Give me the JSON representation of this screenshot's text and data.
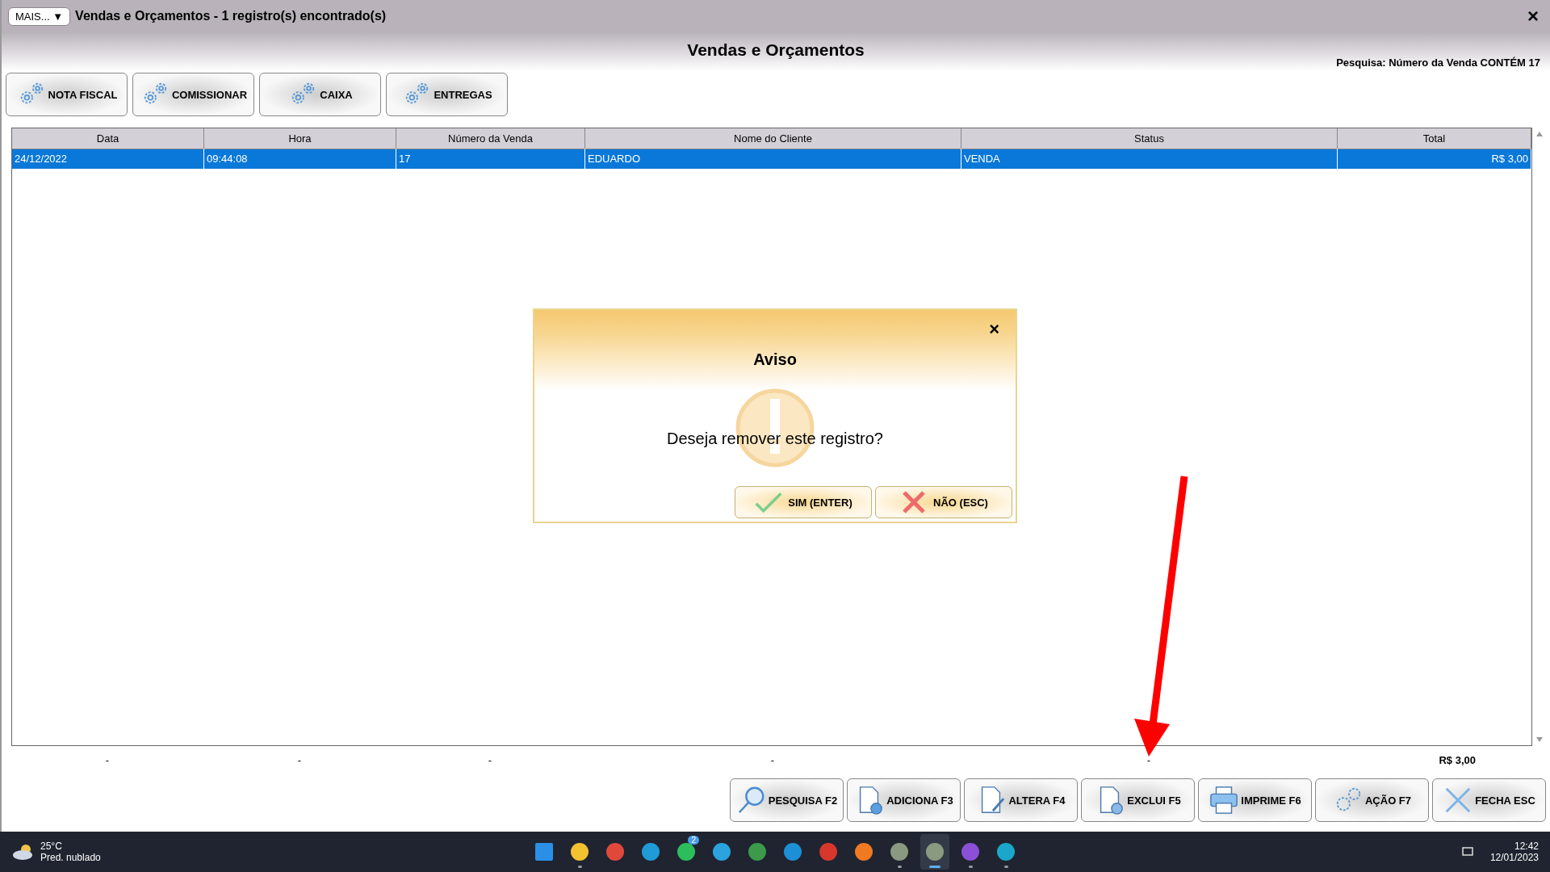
{
  "window": {
    "menu_button": "MAIS...",
    "menu_caret": "▼",
    "title": "Vendas e Orçamentos - 1 registro(s) encontrado(s)",
    "close": "×"
  },
  "heading": "Vendas e Orçamentos",
  "search_summary": "Pesquisa: Número da Venda CONTÉM 17",
  "toolbar": [
    "NOTA FISCAL",
    "COMISSIONAR",
    "CAIXA",
    "ENTREGAS"
  ],
  "table": {
    "columns": [
      "Data",
      "Hora",
      "Número da Venda",
      "Nome do Cliente",
      "Status",
      "Total"
    ],
    "rows": [
      {
        "selected": true,
        "cells": [
          "24/12/2022",
          "09:44:08",
          "17",
          "EDUARDO",
          "VENDA",
          "R$ 3,00"
        ]
      }
    ],
    "footer": [
      "-",
      "-",
      "-",
      "-",
      "-",
      "R$ 3,00"
    ]
  },
  "dialog": {
    "title": "Aviso",
    "close": "×",
    "message": "Deseja remover este registro?",
    "buttons": [
      {
        "kind": "confirm",
        "label": "SIM (ENTER)"
      },
      {
        "kind": "cancel",
        "label": "NÃO (ESC)"
      }
    ]
  },
  "actions": [
    {
      "kind": "search",
      "label": "PESQUISA F2"
    },
    {
      "kind": "add",
      "label": "ADICIONA F3"
    },
    {
      "kind": "edit",
      "label": "ALTERA F4"
    },
    {
      "kind": "delete",
      "label": "EXCLUI F5"
    },
    {
      "kind": "print",
      "label": "IMPRIME F6"
    },
    {
      "kind": "gear",
      "label": "AÇÃO F7"
    },
    {
      "kind": "close",
      "label": "FECHA ESC"
    }
  ],
  "taskbar": {
    "weather": {
      "temperature": "25°C",
      "condition": "Pred. nublado"
    },
    "apps": [
      {
        "kind": "start",
        "running": false,
        "selected": false
      },
      {
        "kind": "folder",
        "running": true,
        "selected": false
      },
      {
        "kind": "chrome",
        "running": false,
        "selected": false
      },
      {
        "kind": "edge",
        "running": false,
        "selected": false
      },
      {
        "kind": "chat",
        "running": false,
        "selected": false,
        "badge": "2"
      },
      {
        "kind": "telegram",
        "running": false,
        "selected": false
      },
      {
        "kind": "sheet",
        "running": false,
        "selected": false
      },
      {
        "kind": "sync",
        "running": false,
        "selected": false
      },
      {
        "kind": "red",
        "running": false,
        "selected": false
      },
      {
        "kind": "firefox",
        "running": false,
        "selected": false
      },
      {
        "kind": "s-app",
        "running": true,
        "selected": false
      },
      {
        "kind": "s-app",
        "running": true,
        "selected": true
      },
      {
        "kind": "purple",
        "running": true,
        "selected": false
      },
      {
        "kind": "teal",
        "running": true,
        "selected": false
      }
    ],
    "time": "12:42",
    "date": "12/01/2023"
  }
}
